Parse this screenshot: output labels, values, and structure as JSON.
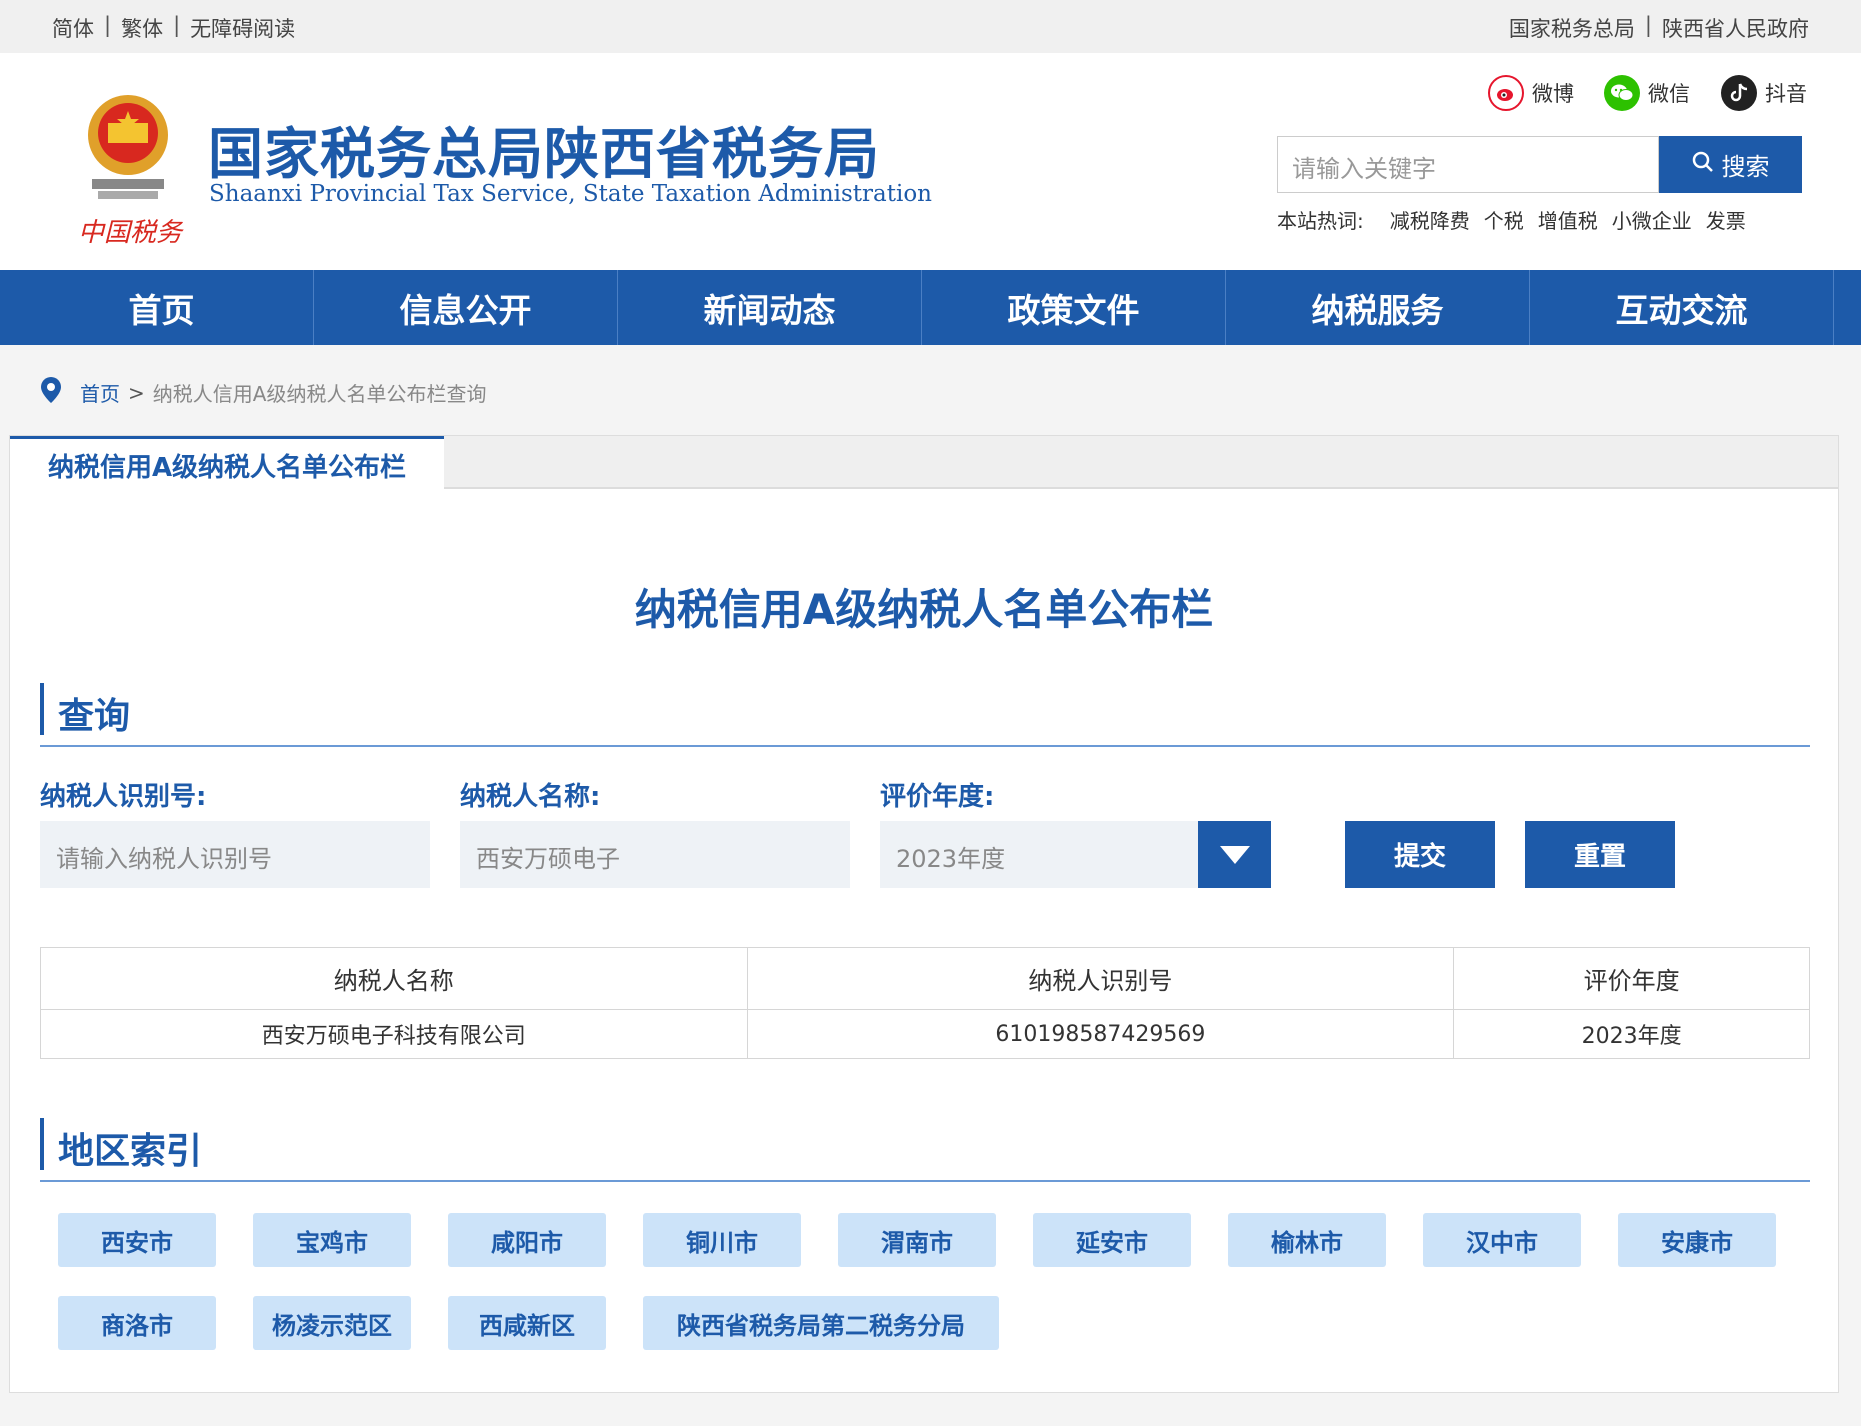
{
  "topbar": {
    "left": [
      "简体",
      "繁体",
      "无障碍阅读"
    ],
    "right": [
      "国家税务总局",
      "陕西省人民政府"
    ]
  },
  "header": {
    "title": "国家税务总局陕西省税务局",
    "subtitle": "Shaanxi Provincial Tax Service, State Taxation Administration",
    "emblem_text": "中国税务",
    "social": [
      {
        "label": "微博",
        "icon": "weibo-icon",
        "color": "#e6162d"
      },
      {
        "label": "微信",
        "icon": "wechat-icon",
        "color": "#2dc100"
      },
      {
        "label": "抖音",
        "icon": "douyin-icon",
        "color": "#222222"
      }
    ],
    "search": {
      "placeholder": "请输入关键字",
      "button": "搜索"
    },
    "hot": {
      "label": "本站热词:",
      "keywords": [
        "减税降费",
        "个税",
        "增值税",
        "小微企业",
        "发票"
      ]
    }
  },
  "nav": [
    "首页",
    "信息公开",
    "新闻动态",
    "政策文件",
    "纳税服务",
    "互动交流"
  ],
  "breadcrumb": {
    "home": "首页",
    "separator": ">",
    "current": "纳税人信用A级纳税人名单公布栏查询"
  },
  "tab": "纳税信用A级纳税人名单公布栏",
  "page_title": "纳税信用A级纳税人名单公布栏",
  "query": {
    "heading": "查询",
    "fields": [
      {
        "label": "纳税人识别号:",
        "placeholder": "请输入纳税人识别号",
        "value": ""
      },
      {
        "label": "纳税人名称:",
        "placeholder": "",
        "value": "西安万硕电子"
      },
      {
        "label": "评价年度:",
        "value": "2023年度"
      }
    ],
    "submit": "提交",
    "reset": "重置"
  },
  "table": {
    "headers": [
      "纳税人名称",
      "纳税人识别号",
      "评价年度"
    ],
    "rows": [
      [
        "西安万硕电子科技有限公司",
        "610198587429569",
        "2023年度"
      ]
    ]
  },
  "regions": {
    "heading": "地区索引",
    "items": [
      "西安市",
      "宝鸡市",
      "咸阳市",
      "铜川市",
      "渭南市",
      "延安市",
      "榆林市",
      "汉中市",
      "安康市",
      "商洛市",
      "杨凌示范区",
      "西咸新区",
      "陕西省税务局第二税务分局"
    ]
  },
  "colors": {
    "primary": "#1d5aa9",
    "region_bg": "#cce3f9",
    "field_bg": "#eef2f6"
  }
}
